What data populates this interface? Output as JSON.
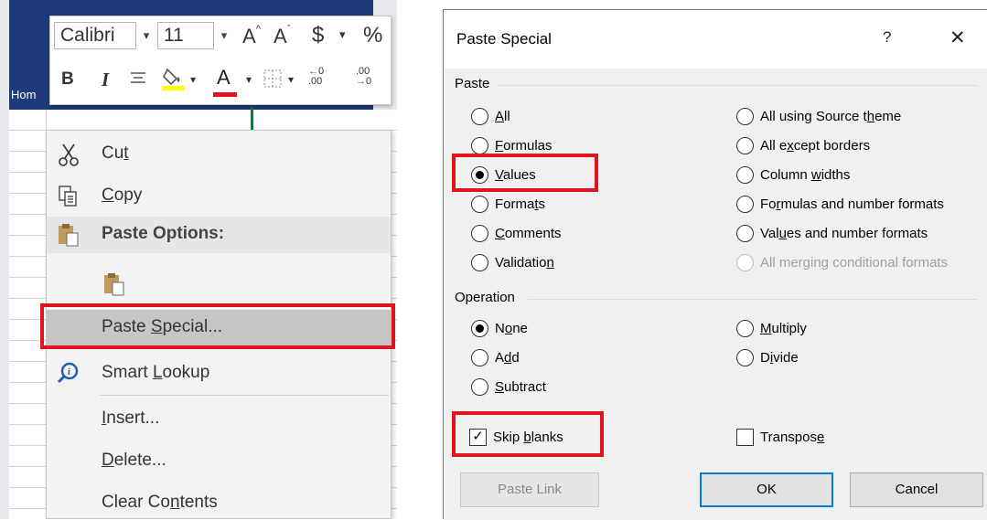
{
  "mini_toolbar": {
    "font_name": "Calibri",
    "font_size": "11",
    "grow_font": "A",
    "shrink_font": "A",
    "currency": "$",
    "percent": "%",
    "bold": "B",
    "italic": "I",
    "font_color_letter": "A",
    "inc_decimal_top": "0",
    "inc_decimal_bottom": ".00",
    "dec_decimal_top": ".00",
    "dec_decimal_bottom": "0",
    "highlight_color": "#ffff00",
    "font_color": "#e81123"
  },
  "ribbon": {
    "home_tab": "Hom"
  },
  "context_menu": {
    "cut": "Cut",
    "copy": "Copy",
    "paste_options": "Paste Options:",
    "paste_special": "Paste Special...",
    "smart_lookup": "Smart Lookup",
    "insert": "Insert...",
    "delete": "Delete...",
    "clear_contents": "Clear Contents"
  },
  "dialog": {
    "title": "Paste Special",
    "help": "?",
    "close": "✕",
    "paste_group": "Paste",
    "paste_options_left": [
      "All",
      "Formulas",
      "Values",
      "Formats",
      "Comments",
      "Validation"
    ],
    "paste_options_right": [
      "All using Source theme",
      "All except borders",
      "Column widths",
      "Formulas and number formats",
      "Values and number formats",
      "All merging conditional formats"
    ],
    "paste_selected": "Values",
    "operation_group": "Operation",
    "operation_options_left": [
      "None",
      "Add",
      "Subtract"
    ],
    "operation_options_right": [
      "Multiply",
      "Divide"
    ],
    "operation_selected": "None",
    "skip_blanks": {
      "label": "Skip blanks",
      "checked": true
    },
    "transpose": {
      "label": "Transpose",
      "checked": false
    },
    "buttons": {
      "paste_link": "Paste Link",
      "ok": "OK",
      "cancel": "Cancel"
    }
  },
  "colors": {
    "highlight_red": "#e0141e",
    "ribbon_blue": "#1e3a78",
    "excel_green": "#217346",
    "ok_border": "#0078d7"
  }
}
